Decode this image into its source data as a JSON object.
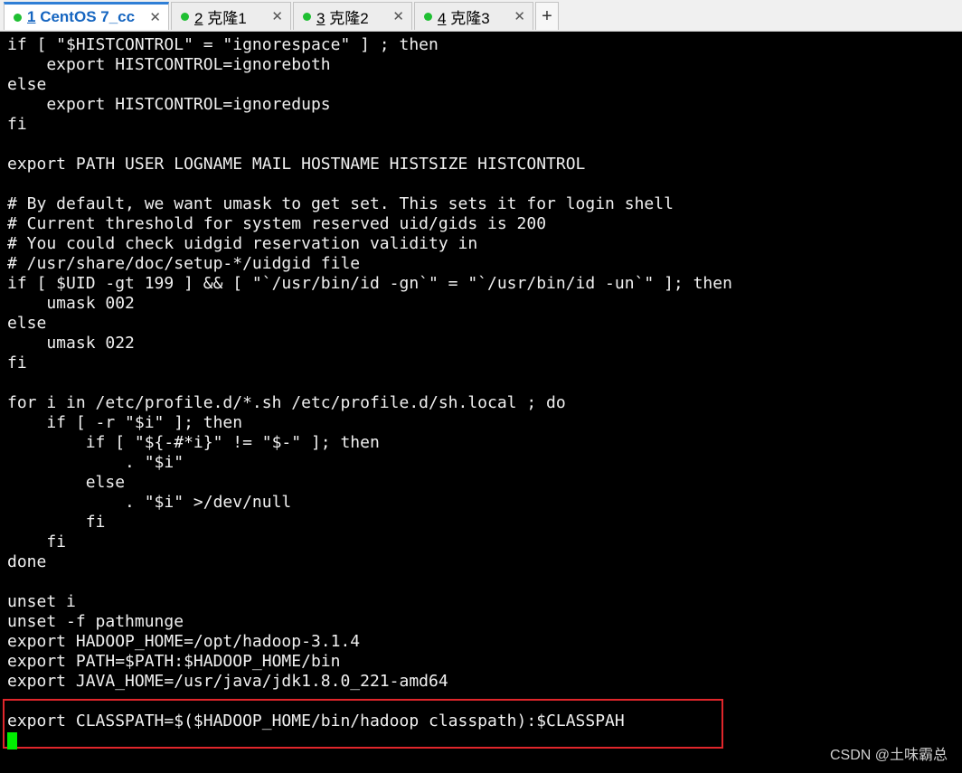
{
  "tabs": [
    {
      "number": "1",
      "label": " CentOS 7_cc",
      "active": true,
      "status_color": "#1fbf32"
    },
    {
      "number": "2",
      "label": " 克隆1",
      "active": false,
      "status_color": "#1fbf32"
    },
    {
      "number": "3",
      "label": " 克隆2",
      "active": false,
      "status_color": "#1fbf32"
    },
    {
      "number": "4",
      "label": " 克隆3",
      "active": false,
      "status_color": "#1fbf32"
    }
  ],
  "new_tab_label": "+",
  "close_glyph": "✕",
  "terminal": {
    "lines": [
      "if [ \"$HISTCONTROL\" = \"ignorespace\" ] ; then",
      "    export HISTCONTROL=ignoreboth",
      "else",
      "    export HISTCONTROL=ignoredups",
      "fi",
      "",
      "export PATH USER LOGNAME MAIL HOSTNAME HISTSIZE HISTCONTROL",
      "",
      "# By default, we want umask to get set. This sets it for login shell",
      "# Current threshold for system reserved uid/gids is 200",
      "# You could check uidgid reservation validity in",
      "# /usr/share/doc/setup-*/uidgid file",
      "if [ $UID -gt 199 ] && [ \"`/usr/bin/id -gn`\" = \"`/usr/bin/id -un`\" ]; then",
      "    umask 002",
      "else",
      "    umask 022",
      "fi",
      "",
      "for i in /etc/profile.d/*.sh /etc/profile.d/sh.local ; do",
      "    if [ -r \"$i\" ]; then",
      "        if [ \"${-#*i}\" != \"$-\" ]; then",
      "            . \"$i\"",
      "        else",
      "            . \"$i\" >/dev/null",
      "        fi",
      "    fi",
      "done",
      "",
      "unset i",
      "unset -f pathmunge",
      "export HADOOP_HOME=/opt/hadoop-3.1.4",
      "export PATH=$PATH:$HADOOP_HOME/bin",
      "export JAVA_HOME=/usr/java/jdk1.8.0_221-amd64",
      "",
      "export CLASSPATH=$($HADOOP_HOME/bin/hadoop classpath):$CLASSPAH"
    ],
    "text_color": "#f0f0f0",
    "cursor_color": "#00ee00",
    "highlight_color": "#e0262b"
  },
  "watermark": "CSDN @土味霸总"
}
